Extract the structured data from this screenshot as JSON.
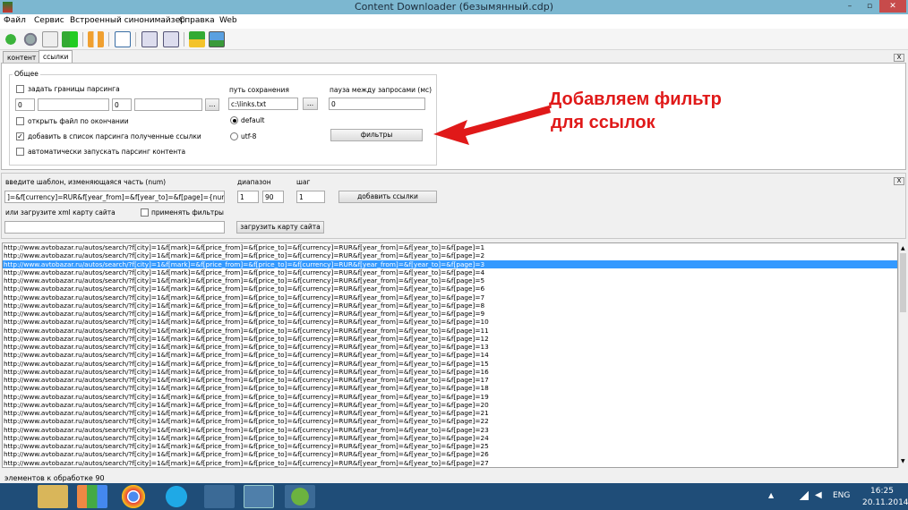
{
  "window": {
    "title": "Content Downloader (безымянный.cdp)",
    "minimize": "–",
    "maximize": "▫",
    "close": "✕"
  },
  "menu": [
    "Файл",
    "Сервис",
    "Встроенный синонимайзер",
    "Справка",
    "Web"
  ],
  "tabs": [
    "контент",
    "ссылки"
  ],
  "settings": {
    "group_title": "Общее",
    "set_limits": "задать границы парсинга",
    "from_value": "0",
    "to_value": "0",
    "browse": "...",
    "open_file": "открыть файл по окончании",
    "add_to_list": "добавить в список парсинга полученные ссылки",
    "auto_start": "автоматически запускать парсинг контента",
    "save_path_label": "путь сохранения",
    "save_path_value": "c:\\links.txt",
    "encoding_default": "default",
    "encoding_utf8": "utf-8",
    "pause_label": "пауза между запросами (мс)",
    "pause_value": "0",
    "filters_button": "фильтры",
    "close_x": "X"
  },
  "annotation": {
    "line1": "Добавляем фильтр",
    "line2": "для ссылок"
  },
  "template": {
    "pattern_label": "введите шаблон, изменяющаяся часть (num)",
    "pattern_value": "]=&f[currency]=RUR&f[year_from]=&f[year_to]=&f[page]={num}",
    "range_label": "диапазон",
    "range_from": "1",
    "range_to": "90",
    "step_label": "шаг",
    "step_value": "1",
    "add_links_button": "добавить ссылки",
    "xml_label": "или загрузите xml карту сайта",
    "apply_filters": "применять фильтры",
    "xml_value": "",
    "load_sitemap_button": "загрузить карту сайта",
    "close_x": "X"
  },
  "links_prefix": "http://www.avtobazar.ru/autos/search/?f[city]=1&f[mark]=&f[price_from]=&f[price_to]=&f[currency]=RUR&f[year_from]=&f[year_to]=&f[page]=",
  "links_pages": [
    "1",
    "2",
    "3",
    "4",
    "5",
    "6",
    "7",
    "8",
    "9",
    "10",
    "11",
    "12",
    "13",
    "14",
    "15",
    "16",
    "17",
    "18",
    "19",
    "20",
    "21",
    "22",
    "23",
    "24",
    "25",
    "26",
    "27"
  ],
  "selected_page": "3",
  "status": "элементов к обработке 90",
  "taskbar": {
    "lang": "ENG",
    "time": "16:25",
    "date": "20.11.2014"
  },
  "colors": {
    "accent": "#3399ff",
    "annotation": "#e01919",
    "titlebar": "#7cb7d0",
    "taskbar": "#1f4d78"
  }
}
